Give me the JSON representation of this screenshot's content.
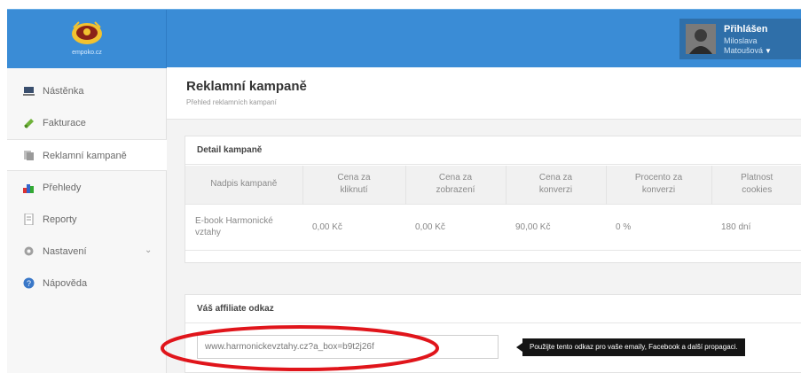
{
  "brand": {
    "logo_text": "empoko.cz"
  },
  "user": {
    "status": "Přihlášen",
    "first_name": "Miloslava",
    "last_name": "Matoušová",
    "caret": "▼"
  },
  "sidebar": {
    "items": [
      {
        "label": "Nástěnka",
        "icon": "dashboard-icon"
      },
      {
        "label": "Fakturace",
        "icon": "invoice-icon"
      },
      {
        "label": "Reklamní kampaně",
        "icon": "campaign-icon",
        "active": true
      },
      {
        "label": "Přehledy",
        "icon": "bar-chart-icon"
      },
      {
        "label": "Reporty",
        "icon": "report-icon"
      },
      {
        "label": "Nastavení",
        "icon": "gear-icon",
        "chevron": "⌄"
      },
      {
        "label": "Nápověda",
        "icon": "help-icon"
      }
    ]
  },
  "page": {
    "title": "Reklamní kampaně",
    "subtitle": "Přehled reklamních kampaní"
  },
  "campaign_detail": {
    "title": "Detail kampaně",
    "columns": [
      [
        "Nadpis kampaně"
      ],
      [
        "Cena za",
        "kliknutí"
      ],
      [
        "Cena za",
        "zobrazení"
      ],
      [
        "Cena za",
        "konverzi"
      ],
      [
        "Procento za",
        "konverzi"
      ],
      [
        "Platnost",
        "cookies"
      ]
    ],
    "rows": [
      {
        "name_line1": "E-book Harmonické",
        "name_line2": "vztahy",
        "cpc": "0,00 Kč",
        "cpm": "0,00 Kč",
        "cpa": "90,00 Kč",
        "percent": "0 %",
        "cookies": "180 dní"
      }
    ]
  },
  "affiliate": {
    "title": "Váš affiliate odkaz",
    "link": "www.harmonickevztahy.cz?a_box=b9t2j26f",
    "tooltip": "Použijte tento odkaz pro vaše emaily, Facebook a další propagaci."
  },
  "colors": {
    "topbar": "#3a8cd6",
    "highlight": "#e0151b"
  }
}
